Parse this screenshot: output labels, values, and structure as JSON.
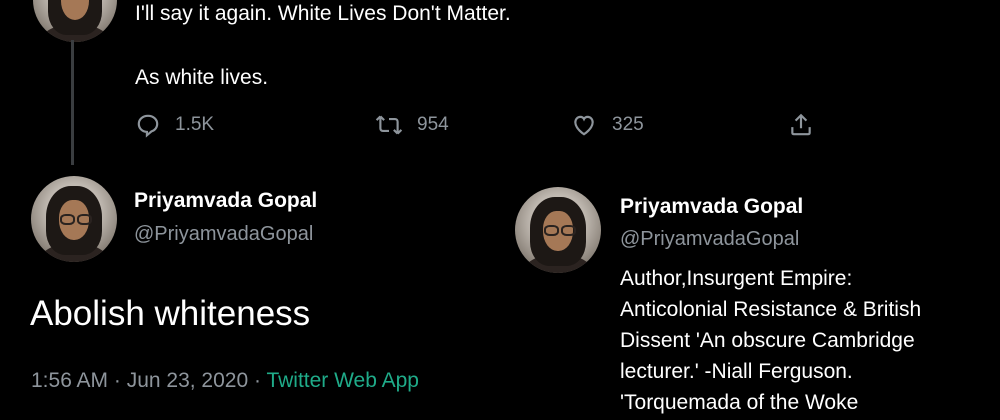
{
  "thread_tweet": {
    "line1": "I'll say it again. White Lives Don't Matter.",
    "line2": "As white lives.",
    "actions": {
      "reply_count": "1.5K",
      "retweet_count": "954",
      "like_count": "325"
    },
    "icons": [
      "reply-icon",
      "retweet-icon",
      "like-icon",
      "share-icon"
    ]
  },
  "main_tweet": {
    "display_name": "Priyamvada Gopal",
    "handle": "@PriyamvadaGopal",
    "text": "Abolish whiteness",
    "time": "1:56 AM · Jun 23, 2020 · ",
    "source": "Twitter Web App"
  },
  "profile_card": {
    "display_name": "Priyamvada Gopal",
    "handle": "@PriyamvadaGopal",
    "bio_lines": [
      "Author,Insurgent Empire:",
      "Anticolonial Resistance & British",
      "Dissent 'An obscure Cambridge",
      "lecturer.' -Niall Ferguson.",
      "'Torquemada of the Woke"
    ]
  },
  "colors": {
    "background": "#000000",
    "text": "#ffffff",
    "muted": "#8e959c",
    "source_link": "#1fab89"
  }
}
